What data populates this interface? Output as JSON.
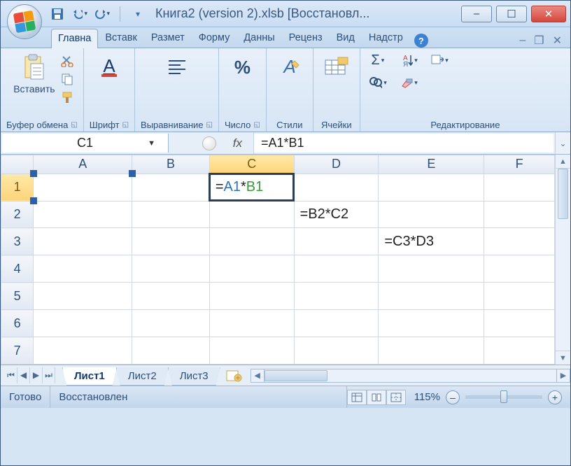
{
  "titlebar": {
    "title": "Книга2 (version 2).xlsb [Восстановл..."
  },
  "qat_icons": [
    "save-icon",
    "undo-icon",
    "redo-icon"
  ],
  "window_controls": {
    "minimize": "–",
    "maximize": "☐",
    "close": "✕"
  },
  "tabs": {
    "items": [
      "Главна",
      "Вставк",
      "Размет",
      "Форму",
      "Данны",
      "Реценз",
      "Вид",
      "Надстр"
    ],
    "active_index": 0
  },
  "ribbon": {
    "paste_label": "Вставить",
    "clipboard_label": "Буфер обмена",
    "font_label": "Шрифт",
    "alignment_label": "Выравнивание",
    "number_label": "Число",
    "styles_label": "Стили",
    "cells_label": "Ячейки",
    "editing_label": "Редактирование"
  },
  "formula_bar": {
    "name_box": "C1",
    "fx_label": "fx",
    "formula": "=A1*B1"
  },
  "grid": {
    "columns": [
      "A",
      "B",
      "C",
      "D",
      "E",
      "F"
    ],
    "active_col": "C",
    "active_row": 1,
    "rows": 7,
    "cells": {
      "C1": {
        "text": "=A1*B1",
        "parts": [
          {
            "t": "=",
            "c": ""
          },
          {
            "t": "A1",
            "c": "a-ref"
          },
          {
            "t": "*",
            "c": ""
          },
          {
            "t": "B1",
            "c": "b-ref"
          }
        ]
      },
      "D2": {
        "text": "=B2*C2"
      },
      "E3": {
        "text": "=C3*D3"
      }
    }
  },
  "sheets": {
    "tabs": [
      "Лист1",
      "Лист2",
      "Лист3"
    ],
    "active_index": 0
  },
  "status": {
    "ready": "Готово",
    "recovery": "Восстановлен",
    "zoom_pct": "115%"
  }
}
